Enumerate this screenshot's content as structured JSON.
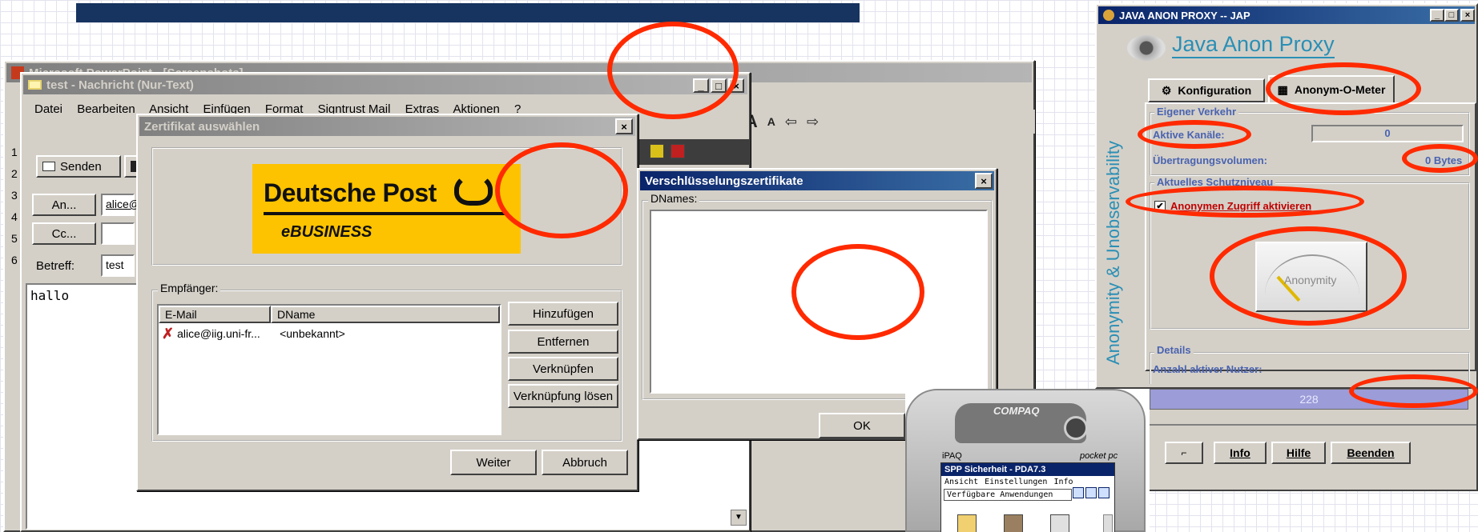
{
  "ppt": {
    "title": "Microsoft PowerPoint - [Screenshots]",
    "lines": [
      "1",
      "2",
      "3",
      "4",
      "5",
      "6"
    ]
  },
  "mail": {
    "title": "test - Nachricht (Nur-Text)",
    "menu": [
      "Datei",
      "Bearbeiten",
      "Ansicht",
      "Einfügen",
      "Format",
      "Signtrust Mail",
      "Extras",
      "Aktionen",
      "?"
    ],
    "send_label": "Senden",
    "to_label": "An...",
    "to_value": "alice@",
    "cc_label": "Cc...",
    "subject_label": "Betreff:",
    "subject_value": "test",
    "body": "hallo"
  },
  "cert_dialog": {
    "title": "Zertifikat auswählen",
    "logo_main": "Deutsche Post",
    "logo_sub": "eBUSINESS",
    "group_label": "Empfänger:",
    "col_email": "E-Mail",
    "col_dname": "DName",
    "row_email": "alice@iig.uni-fr...",
    "row_dname": "<unbekannt>",
    "btn_add": "Hinzufügen",
    "btn_remove": "Entfernen",
    "btn_link": "Verknüpfen",
    "btn_unlink": "Verknüpfung lösen",
    "btn_next": "Weiter",
    "btn_cancel": "Abbruch"
  },
  "enc_dialog": {
    "title": "Verschlüsselungszertifikate",
    "group_label": "DNames:",
    "ok": "OK"
  },
  "jap": {
    "title": "JAVA ANON PROXY -- JAP",
    "brand": "Java Anon Proxy",
    "side_text": "Anonymity & Unobservability",
    "tab_config": "Konfiguration",
    "tab_meter": "Anonym-O-Meter",
    "traffic_group": "Eigener Verkehr",
    "active_channels_label": "Aktive Kanäle:",
    "active_channels_value": "0",
    "volume_label": "Übertragungsvolumen:",
    "volume_value": "0 Bytes",
    "protection_group": "Aktuelles Schutzniveau",
    "anon_checkbox": "Anonymen Zugriff aktivieren",
    "gauge_label": "Anonymity",
    "details_group": "Details",
    "users_label": "Anzahl aktiver Nutzer:",
    "users_value": "228",
    "btn_info": "Info",
    "btn_help": "Hilfe",
    "btn_quit": "Beenden"
  },
  "pda": {
    "brand": "COMPAQ",
    "model": "iPAQ",
    "os": "pocket pc",
    "app_title": "SPP Sicherheit - PDA7.3",
    "menu": [
      "Ansicht",
      "Einstellungen",
      "Info"
    ],
    "dropdown": "Verfügbare Anwendungen"
  },
  "colors": {
    "accent": "#ff2a00",
    "jap_blue": "#2a8fb5",
    "title_blue": "#0a246a"
  }
}
